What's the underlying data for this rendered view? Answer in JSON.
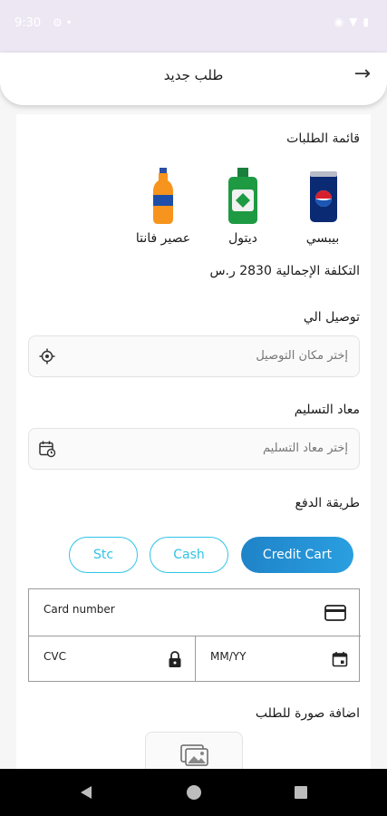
{
  "status_bar": {
    "time": "9:30",
    "left_icons": [
      "settings-icon",
      "dot-icon"
    ],
    "right_icons": [
      "location-icon",
      "wifi-icon",
      "battery-icon"
    ]
  },
  "header": {
    "title": "طلب جديد",
    "back_icon": "arrow-right-icon"
  },
  "order_list": {
    "title": "قائمة الطلبات",
    "products": [
      {
        "name": "بيبسي",
        "icon": "pepsi-can-icon"
      },
      {
        "name": "ديتول",
        "icon": "dettol-bottle-icon"
      },
      {
        "name": "عصير فانتا",
        "icon": "fanta-bottle-icon"
      }
    ]
  },
  "total": {
    "text": "التكلفة الإجمالية 2830 ر.س"
  },
  "delivery": {
    "label": "توصيل الي",
    "placeholder": "إختر مكان التوصيل",
    "icon": "location-target-icon"
  },
  "schedule": {
    "label": "معاد التسليم",
    "placeholder": "إختر معاد التسليم",
    "icon": "calendar-clock-icon"
  },
  "payment": {
    "label": "طريقة الدفع",
    "methods": [
      {
        "label": "Credit Cart",
        "selected": true
      },
      {
        "label": "Cash",
        "selected": false
      },
      {
        "label": "Stc",
        "selected": false
      }
    ],
    "colors": {
      "accent": "#2fc4e6",
      "selected_start": "#1f83c8",
      "selected_end": "#2a9fe0"
    }
  },
  "card_form": {
    "card_number_label": "Card number",
    "cvc_label": "CVC",
    "expiry_label": "MM/YY",
    "card_icon": "credit-card-icon",
    "lock_icon": "lock-icon",
    "calendar_icon": "calendar-icon"
  },
  "attachment": {
    "label": "اضافة صورة للطلب",
    "icon": "add-image-icon"
  },
  "nav": {
    "back": "back-triangle-icon",
    "home": "home-circle-icon",
    "recents": "recents-square-icon"
  }
}
